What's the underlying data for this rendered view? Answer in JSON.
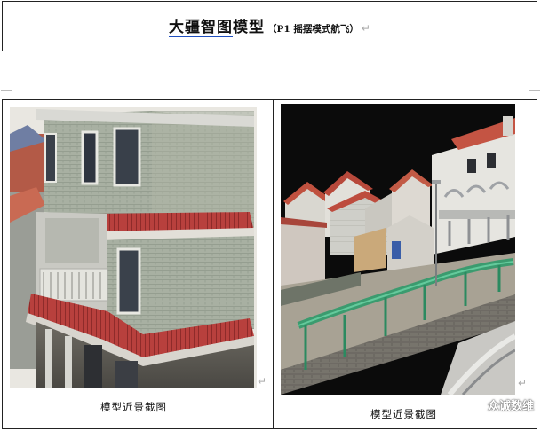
{
  "header": {
    "title_main": "大疆智图模型",
    "title_underlined": "大疆智图",
    "title_rest": "模型",
    "title_sub": "（P1 摇摆模式航飞）",
    "para_mark": "↵"
  },
  "table": {
    "left_caption": "模型近景截图",
    "right_caption": "模型近景截图",
    "cell_mark": "↵",
    "left_image_alt": "",
    "right_image_alt": ""
  },
  "watermark": {
    "text": "众诚数维",
    "icon": "wechat-icon"
  },
  "colors": {
    "border": "#222222",
    "underline": "#1f4fbf",
    "para_mark": "#aaaaaa",
    "roof_red": "#b8403d",
    "wall_gray": "#9fa89a",
    "guardrail_green": "#2f9a6a",
    "night_sky": "#0b0b0b"
  }
}
